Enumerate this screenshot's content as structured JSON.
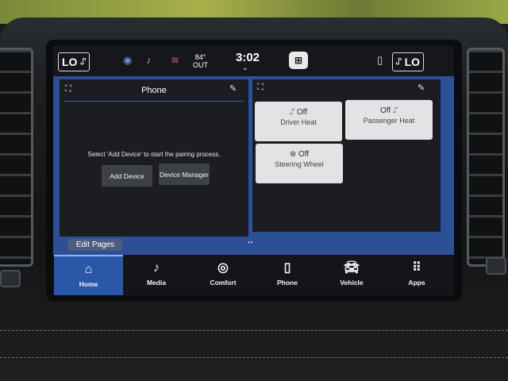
{
  "status_bar": {
    "left_climate": "LO",
    "right_climate": "LO",
    "temperature": "84°",
    "temperature_label": "OUT",
    "time": "3:02"
  },
  "phone_panel": {
    "title": "Phone",
    "message": "Select 'Add Device' to start the pairing process.",
    "add_device_label": "Add Device",
    "device_manager_label": "Device Manager"
  },
  "comfort_panel": {
    "tiles": [
      {
        "name": "Driver Heat",
        "state": "Off",
        "icon": "seat-heat-icon"
      },
      {
        "name": "Passenger Heat",
        "state": "Off",
        "icon": "seat-heat-icon"
      },
      {
        "name": "Steering Wheel",
        "state": "Off",
        "icon": "steering-wheel-heat-icon"
      }
    ]
  },
  "edit_pages_label": "Edit Pages",
  "nav": [
    {
      "label": "Home",
      "icon": "home-icon",
      "active": true
    },
    {
      "label": "Media",
      "icon": "music-note-icon"
    },
    {
      "label": "Comfort",
      "icon": "comfort-icon"
    },
    {
      "label": "Phone",
      "icon": "phone-icon"
    },
    {
      "label": "Vehicle",
      "icon": "car-icon"
    },
    {
      "label": "Apps",
      "icon": "grid-icon"
    }
  ],
  "colors": {
    "accent": "#2b57a8",
    "page_background": "#2c4f96",
    "panel_background": "#1b1d20",
    "tile_background": "#e2e3e4"
  }
}
